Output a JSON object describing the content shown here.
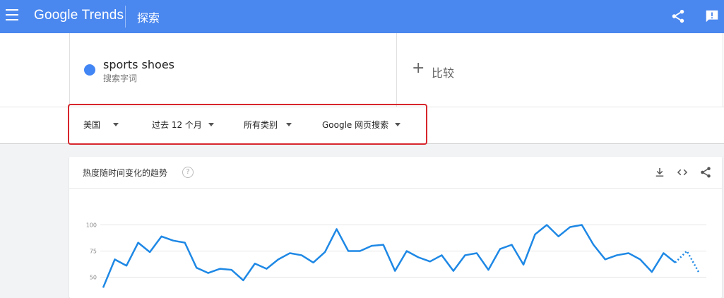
{
  "header": {
    "brand": "Google Trends",
    "section": "探索"
  },
  "term": {
    "name": "sports shoes",
    "type": "搜索字词",
    "color": "#4285f4"
  },
  "compare": {
    "plus": "+",
    "label": "比较"
  },
  "filters": [
    {
      "label": "美国"
    },
    {
      "label": "过去 12 个月"
    },
    {
      "label": "所有类别"
    },
    {
      "label": "Google 网页搜索"
    }
  ],
  "panel": {
    "title": "热度随时间变化的趋势",
    "help": "?"
  },
  "chart_data": {
    "type": "line",
    "y_ticks": [
      100,
      75,
      50
    ],
    "ylim": [
      0,
      100
    ],
    "grid": true,
    "series": [
      {
        "color": "#1e88e5",
        "values": [
          40,
          67,
          61,
          83,
          74,
          89,
          85,
          83,
          59,
          54,
          58,
          57,
          47,
          63,
          58,
          67,
          73,
          71,
          64,
          74,
          96,
          75,
          75,
          80,
          81,
          56,
          75,
          69,
          65,
          71,
          56,
          71,
          73,
          57,
          77,
          81,
          62,
          91,
          100,
          89,
          98,
          100,
          81,
          67,
          71,
          73,
          67,
          55,
          73,
          64,
          75,
          55
        ],
        "partial_last_points": 2
      }
    ]
  }
}
